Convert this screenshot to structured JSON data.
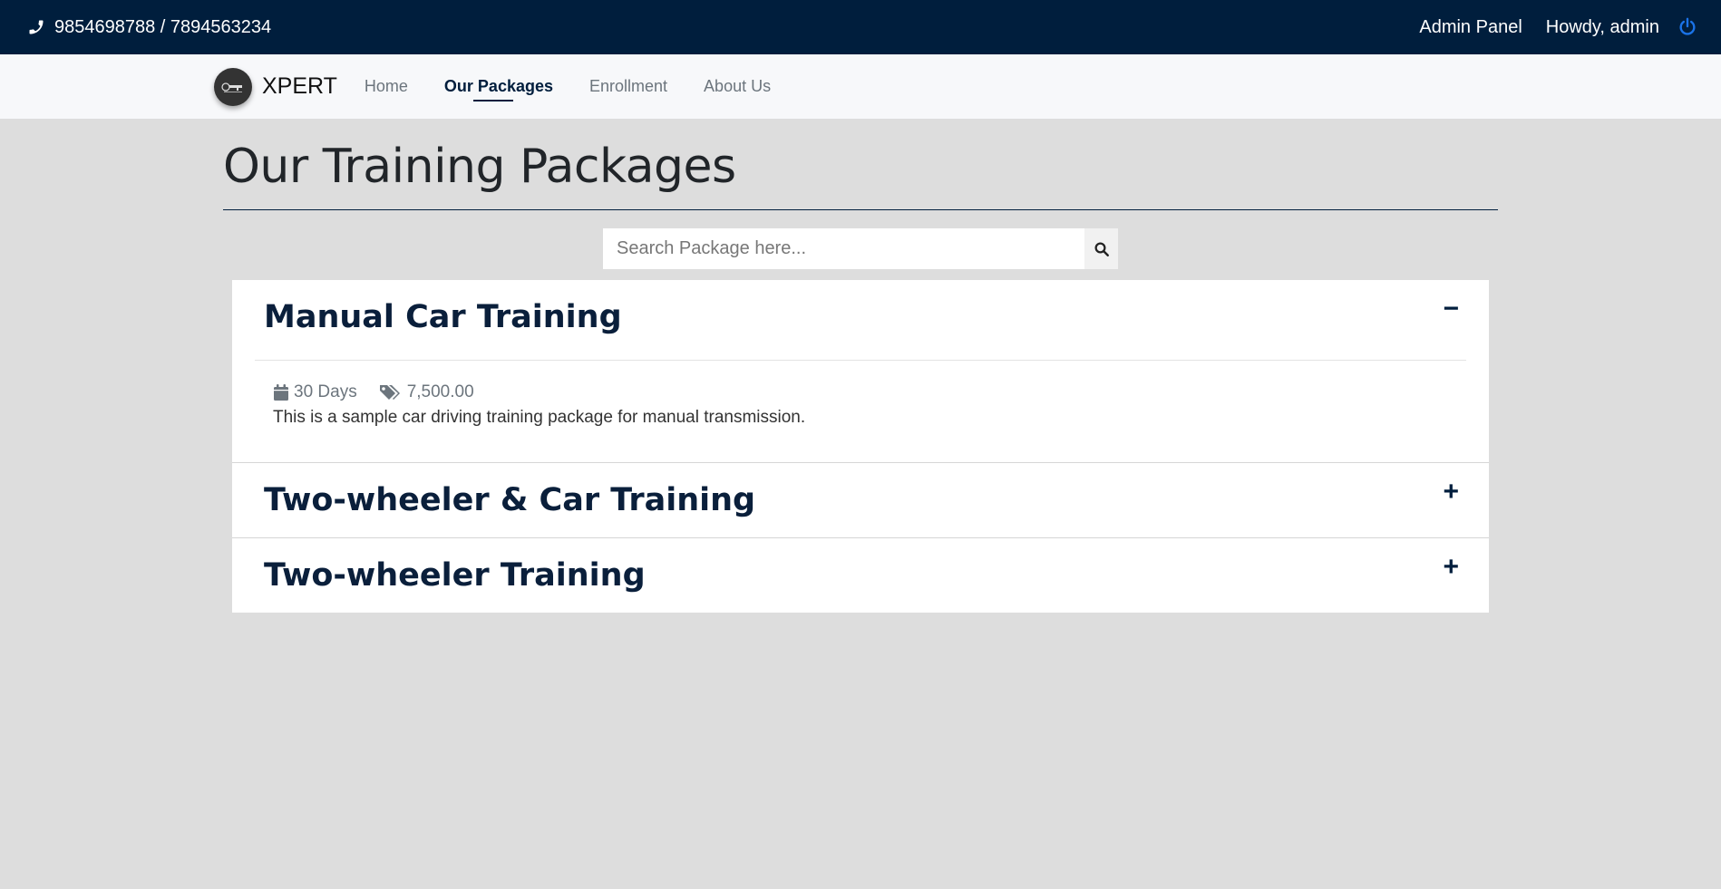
{
  "topbar": {
    "phone": "9854698788 / 7894563234",
    "admin_panel": "Admin Panel",
    "greeting": "Howdy, admin"
  },
  "nav": {
    "brand": "XPERT",
    "items": [
      "Home",
      "Our Packages",
      "Enrollment",
      "About Us"
    ],
    "active": "Our Packages"
  },
  "page": {
    "title": "Our Training Packages"
  },
  "search": {
    "placeholder": "Search Package here..."
  },
  "packages": [
    {
      "title": "Manual Car Training",
      "expanded": true,
      "toggle": "−",
      "duration": "30 Days",
      "price": "7,500.00",
      "description": "This is a sample car driving training package for manual transmission."
    },
    {
      "title": "Two-wheeler & Car Training",
      "expanded": false,
      "toggle": "+"
    },
    {
      "title": "Two-wheeler Training",
      "expanded": false,
      "toggle": "+"
    }
  ],
  "colors": {
    "topbar_bg": "#001e3d",
    "accent_power": "#1a73e8",
    "page_bg": "#dddddd"
  }
}
